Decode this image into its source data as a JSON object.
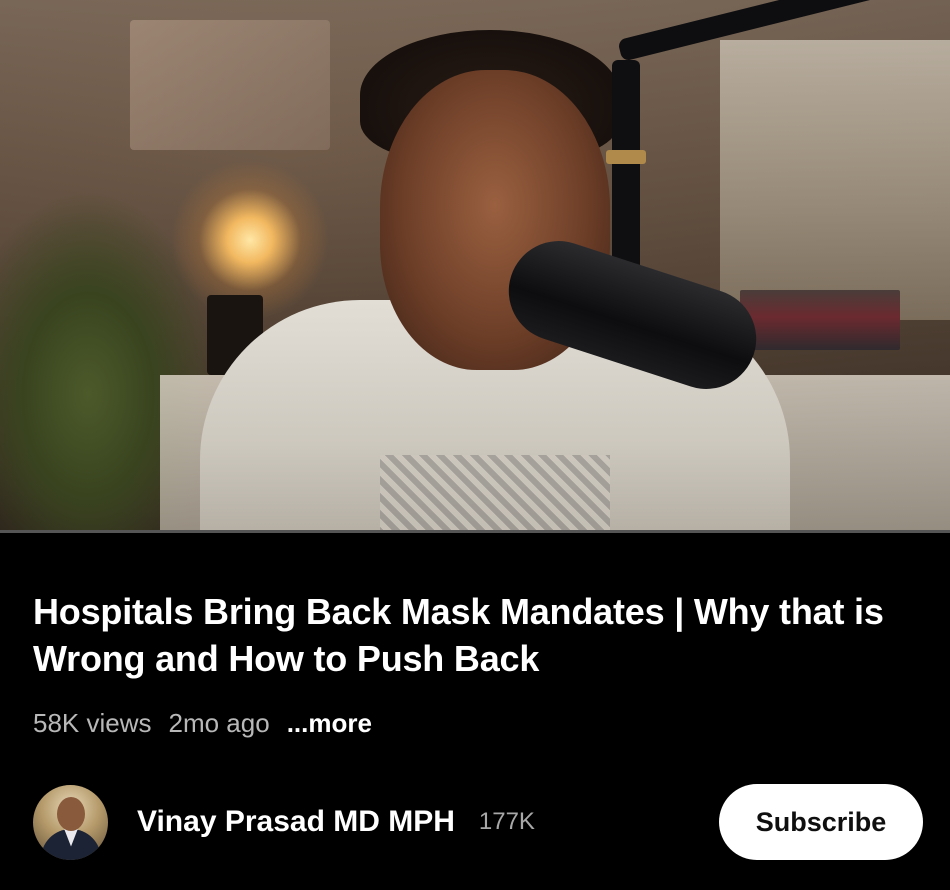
{
  "video": {
    "thumbnail_icon": "video-frame"
  },
  "title": "Hospitals Bring Back Mask Mandates | Why that is Wrong and How to Push Back",
  "meta": {
    "views": "58K views",
    "age": "2mo ago",
    "more_label": "...more"
  },
  "channel": {
    "name": "Vinay Prasad MD MPH",
    "subscribers": "177K",
    "avatar_icon": "channel-avatar",
    "subscribe_label": "Subscribe"
  }
}
